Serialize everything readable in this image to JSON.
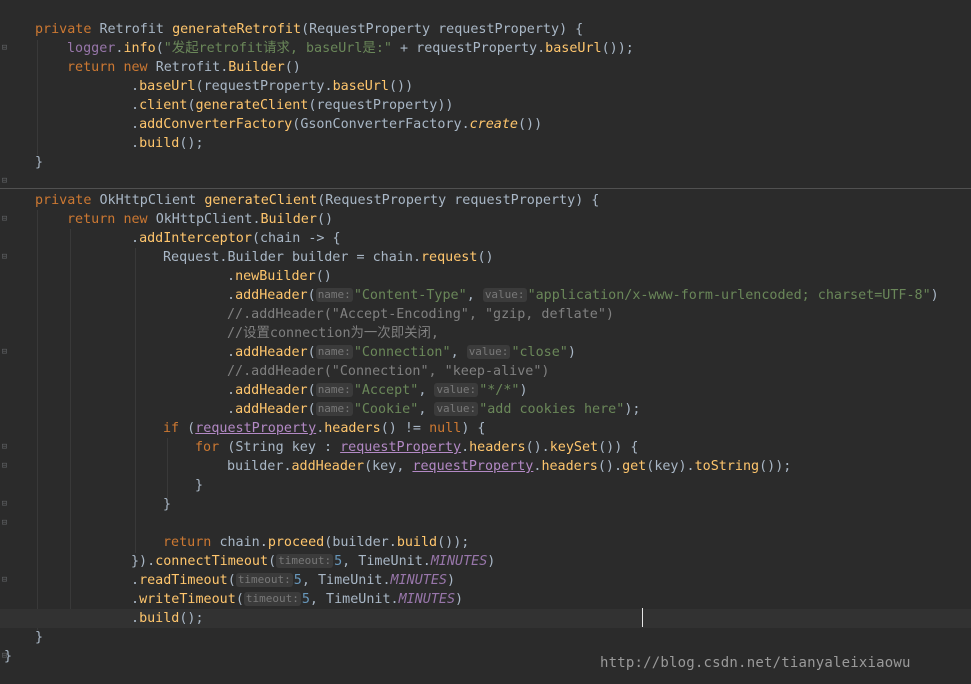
{
  "editor": {
    "watermark": "http://blog.csdn.net/tianyaleixiaowu"
  },
  "tokens": {
    "private": "private",
    "return": "return",
    "new": "new",
    "if": "if",
    "for": "for",
    "null": "null",
    "retrofit_type": "Retrofit",
    "okhttp_type": "OkHttpClient",
    "request_property_type": "RequestProperty",
    "request_property_param": "requestProperty",
    "gen_retrofit": "generateRetrofit",
    "gen_client": "generateClient",
    "logger": "logger",
    "info": "info",
    "log_message": "\"发起retrofit请求, baseUrl是:\"",
    "plus": "+",
    "base_url": "baseUrl",
    "builder": "Builder",
    "client": "client",
    "add_converter_factory": "addConverterFactory",
    "gson_factory": "GsonConverterFactory",
    "create": "create",
    "build": "build",
    "add_interceptor": "addInterceptor",
    "chain": "chain",
    "arrow": "->",
    "request_builder_type": "Request.Builder",
    "builder_var": "builder",
    "request": "request",
    "new_builder": "newBuilder",
    "add_header": "addHeader",
    "hint_name": "name:",
    "hint_value": "value:",
    "hint_timeout": "timeout:",
    "content_type_key": "\"Content-Type\"",
    "content_type_val": "\"application/x-www-form-urlencoded; charset=UTF-8\"",
    "comment_accept_encoding": "//.addHeader(\"Accept-Encoding\", \"gzip, deflate\")",
    "comment_connection_cn": "//设置connection为一次即关闭,",
    "connection_key": "\"Connection\"",
    "close_val": "\"close\"",
    "comment_keep_alive": "//.addHeader(\"Connection\", \"keep-alive\")",
    "accept_key": "\"Accept\"",
    "accept_val": "\"*/*\"",
    "cookie_key": "\"Cookie\"",
    "cookie_val": "\"add cookies here\"",
    "headers": "headers",
    "string_type": "String",
    "key": "key",
    "key_set": "keySet",
    "get": "get",
    "to_string": "toString",
    "proceed": "proceed",
    "connect_timeout": "connectTimeout",
    "read_timeout": "readTimeout",
    "write_timeout": "writeTimeout",
    "five": "5",
    "time_unit": "TimeUnit",
    "minutes": "MINUTES"
  }
}
